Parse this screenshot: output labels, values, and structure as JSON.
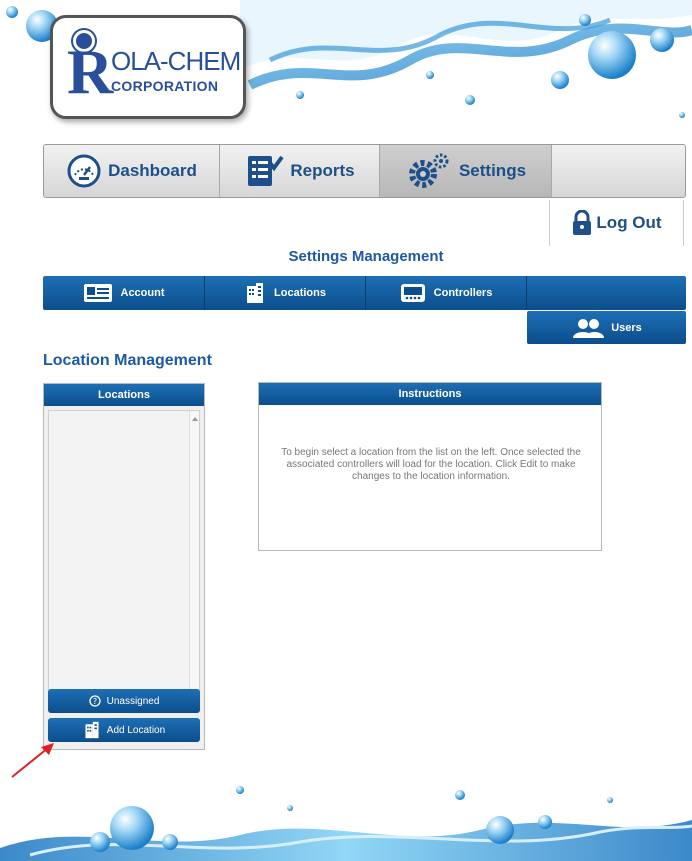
{
  "logo": {
    "letter": "R",
    "word": "OLA-CHEM",
    "corp": "CORPORATION"
  },
  "main_nav": {
    "dashboard": "Dashboard",
    "reports": "Reports",
    "settings": "Settings"
  },
  "logout": "Log Out",
  "settings_title": "Settings Management",
  "sub_nav": {
    "account": "Account",
    "locations": "Locations",
    "controllers": "Controllers",
    "users": "Users"
  },
  "section_title": "Location Management",
  "locations_panel": {
    "header": "Locations",
    "unassigned": "Unassigned",
    "add_location": "Add Location"
  },
  "instructions_panel": {
    "header": "Instructions",
    "text": "To begin select a location from the list on the left. Once selected the associated controllers will load for the location. Click Edit to make changes to the location information."
  },
  "colors": {
    "brand_blue": "#1e5aa0",
    "tab_blue": "#0c4e8c",
    "annotation_red": "#e02020"
  },
  "icons": [
    "dashboard-gauge-icon",
    "reports-icon",
    "settings-gears-icon",
    "lock-icon",
    "account-card-icon",
    "building-icon",
    "controller-icon",
    "users-icon",
    "question-icon",
    "red-arrow"
  ]
}
